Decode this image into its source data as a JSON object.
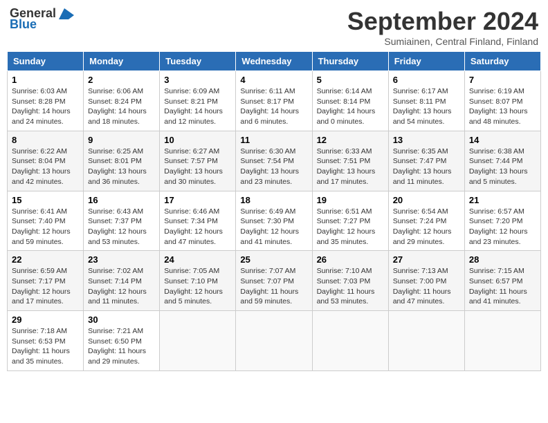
{
  "header": {
    "logo_general": "General",
    "logo_blue": "Blue",
    "month_title": "September 2024",
    "location": "Sumiainen, Central Finland, Finland"
  },
  "weekdays": [
    "Sunday",
    "Monday",
    "Tuesday",
    "Wednesday",
    "Thursday",
    "Friday",
    "Saturday"
  ],
  "weeks": [
    [
      {
        "day": "1",
        "sunrise": "Sunrise: 6:03 AM",
        "sunset": "Sunset: 8:28 PM",
        "daylight": "Daylight: 14 hours and 24 minutes."
      },
      {
        "day": "2",
        "sunrise": "Sunrise: 6:06 AM",
        "sunset": "Sunset: 8:24 PM",
        "daylight": "Daylight: 14 hours and 18 minutes."
      },
      {
        "day": "3",
        "sunrise": "Sunrise: 6:09 AM",
        "sunset": "Sunset: 8:21 PM",
        "daylight": "Daylight: 14 hours and 12 minutes."
      },
      {
        "day": "4",
        "sunrise": "Sunrise: 6:11 AM",
        "sunset": "Sunset: 8:17 PM",
        "daylight": "Daylight: 14 hours and 6 minutes."
      },
      {
        "day": "5",
        "sunrise": "Sunrise: 6:14 AM",
        "sunset": "Sunset: 8:14 PM",
        "daylight": "Daylight: 14 hours and 0 minutes."
      },
      {
        "day": "6",
        "sunrise": "Sunrise: 6:17 AM",
        "sunset": "Sunset: 8:11 PM",
        "daylight": "Daylight: 13 hours and 54 minutes."
      },
      {
        "day": "7",
        "sunrise": "Sunrise: 6:19 AM",
        "sunset": "Sunset: 8:07 PM",
        "daylight": "Daylight: 13 hours and 48 minutes."
      }
    ],
    [
      {
        "day": "8",
        "sunrise": "Sunrise: 6:22 AM",
        "sunset": "Sunset: 8:04 PM",
        "daylight": "Daylight: 13 hours and 42 minutes."
      },
      {
        "day": "9",
        "sunrise": "Sunrise: 6:25 AM",
        "sunset": "Sunset: 8:01 PM",
        "daylight": "Daylight: 13 hours and 36 minutes."
      },
      {
        "day": "10",
        "sunrise": "Sunrise: 6:27 AM",
        "sunset": "Sunset: 7:57 PM",
        "daylight": "Daylight: 13 hours and 30 minutes."
      },
      {
        "day": "11",
        "sunrise": "Sunrise: 6:30 AM",
        "sunset": "Sunset: 7:54 PM",
        "daylight": "Daylight: 13 hours and 23 minutes."
      },
      {
        "day": "12",
        "sunrise": "Sunrise: 6:33 AM",
        "sunset": "Sunset: 7:51 PM",
        "daylight": "Daylight: 13 hours and 17 minutes."
      },
      {
        "day": "13",
        "sunrise": "Sunrise: 6:35 AM",
        "sunset": "Sunset: 7:47 PM",
        "daylight": "Daylight: 13 hours and 11 minutes."
      },
      {
        "day": "14",
        "sunrise": "Sunrise: 6:38 AM",
        "sunset": "Sunset: 7:44 PM",
        "daylight": "Daylight: 13 hours and 5 minutes."
      }
    ],
    [
      {
        "day": "15",
        "sunrise": "Sunrise: 6:41 AM",
        "sunset": "Sunset: 7:40 PM",
        "daylight": "Daylight: 12 hours and 59 minutes."
      },
      {
        "day": "16",
        "sunrise": "Sunrise: 6:43 AM",
        "sunset": "Sunset: 7:37 PM",
        "daylight": "Daylight: 12 hours and 53 minutes."
      },
      {
        "day": "17",
        "sunrise": "Sunrise: 6:46 AM",
        "sunset": "Sunset: 7:34 PM",
        "daylight": "Daylight: 12 hours and 47 minutes."
      },
      {
        "day": "18",
        "sunrise": "Sunrise: 6:49 AM",
        "sunset": "Sunset: 7:30 PM",
        "daylight": "Daylight: 12 hours and 41 minutes."
      },
      {
        "day": "19",
        "sunrise": "Sunrise: 6:51 AM",
        "sunset": "Sunset: 7:27 PM",
        "daylight": "Daylight: 12 hours and 35 minutes."
      },
      {
        "day": "20",
        "sunrise": "Sunrise: 6:54 AM",
        "sunset": "Sunset: 7:24 PM",
        "daylight": "Daylight: 12 hours and 29 minutes."
      },
      {
        "day": "21",
        "sunrise": "Sunrise: 6:57 AM",
        "sunset": "Sunset: 7:20 PM",
        "daylight": "Daylight: 12 hours and 23 minutes."
      }
    ],
    [
      {
        "day": "22",
        "sunrise": "Sunrise: 6:59 AM",
        "sunset": "Sunset: 7:17 PM",
        "daylight": "Daylight: 12 hours and 17 minutes."
      },
      {
        "day": "23",
        "sunrise": "Sunrise: 7:02 AM",
        "sunset": "Sunset: 7:14 PM",
        "daylight": "Daylight: 12 hours and 11 minutes."
      },
      {
        "day": "24",
        "sunrise": "Sunrise: 7:05 AM",
        "sunset": "Sunset: 7:10 PM",
        "daylight": "Daylight: 12 hours and 5 minutes."
      },
      {
        "day": "25",
        "sunrise": "Sunrise: 7:07 AM",
        "sunset": "Sunset: 7:07 PM",
        "daylight": "Daylight: 11 hours and 59 minutes."
      },
      {
        "day": "26",
        "sunrise": "Sunrise: 7:10 AM",
        "sunset": "Sunset: 7:03 PM",
        "daylight": "Daylight: 11 hours and 53 minutes."
      },
      {
        "day": "27",
        "sunrise": "Sunrise: 7:13 AM",
        "sunset": "Sunset: 7:00 PM",
        "daylight": "Daylight: 11 hours and 47 minutes."
      },
      {
        "day": "28",
        "sunrise": "Sunrise: 7:15 AM",
        "sunset": "Sunset: 6:57 PM",
        "daylight": "Daylight: 11 hours and 41 minutes."
      }
    ],
    [
      {
        "day": "29",
        "sunrise": "Sunrise: 7:18 AM",
        "sunset": "Sunset: 6:53 PM",
        "daylight": "Daylight: 11 hours and 35 minutes."
      },
      {
        "day": "30",
        "sunrise": "Sunrise: 7:21 AM",
        "sunset": "Sunset: 6:50 PM",
        "daylight": "Daylight: 11 hours and 29 minutes."
      },
      null,
      null,
      null,
      null,
      null
    ]
  ]
}
